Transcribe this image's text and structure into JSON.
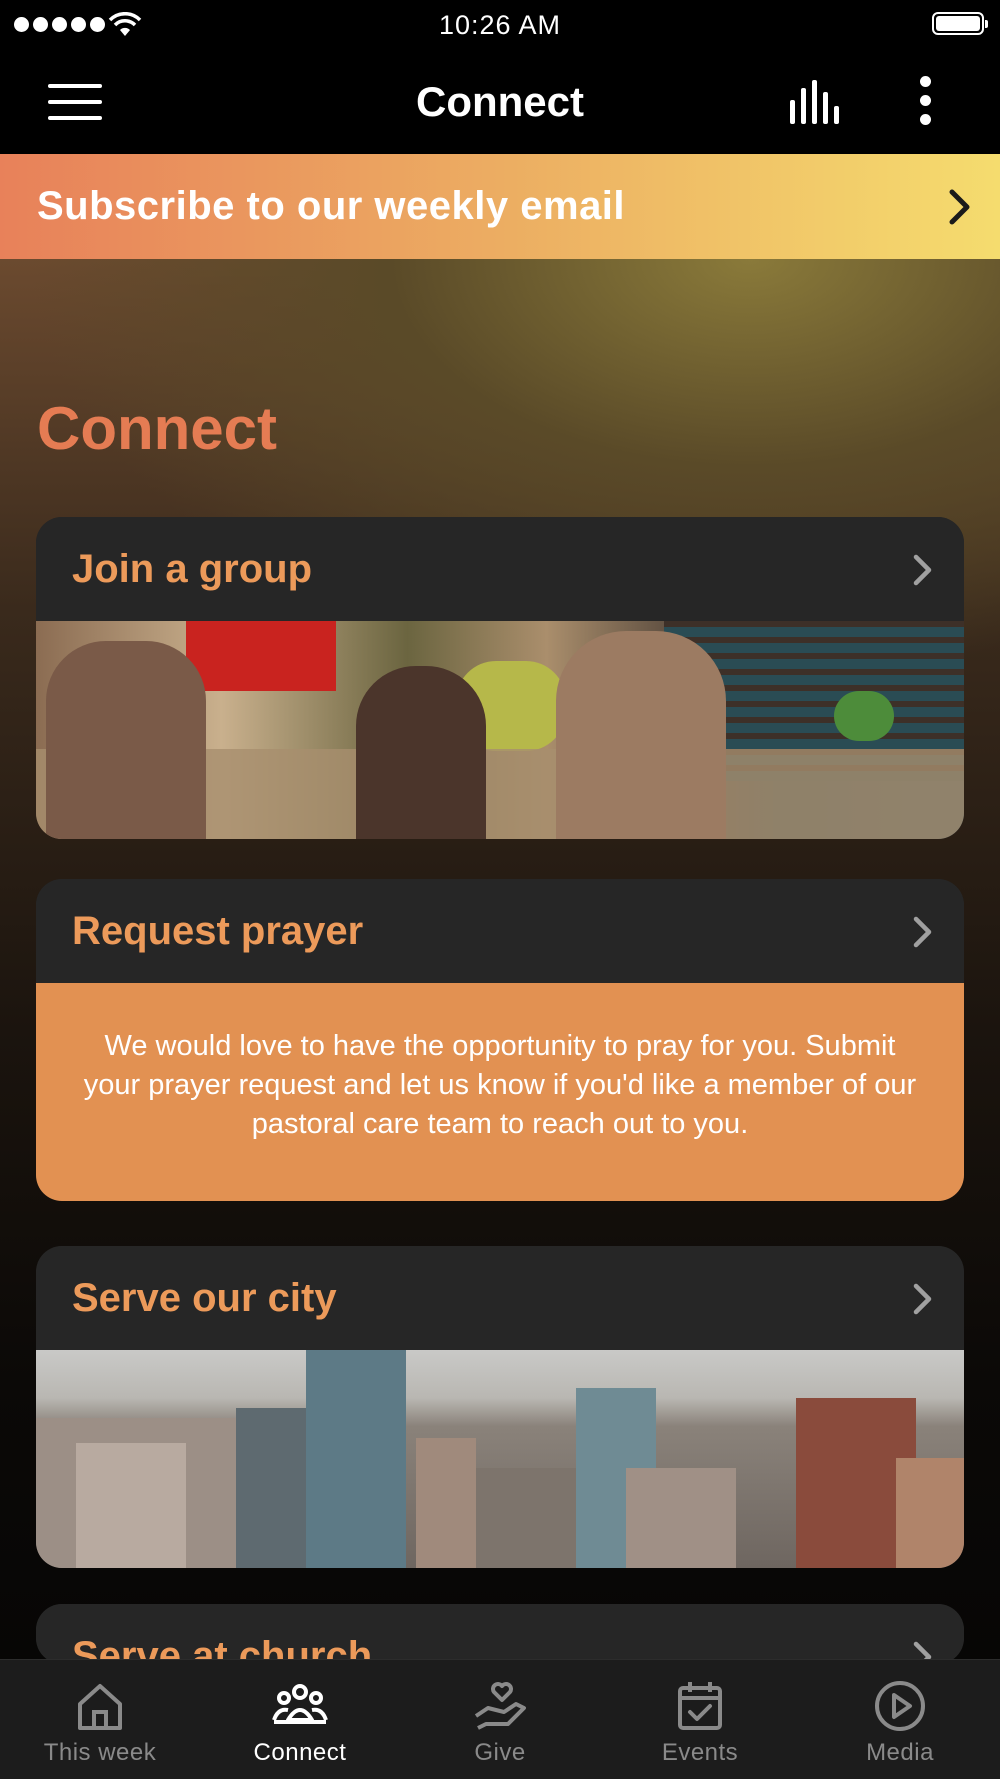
{
  "status_bar": {
    "time": "10:26 AM"
  },
  "nav_bar": {
    "title": "Connect"
  },
  "subscribe_banner": {
    "label": "Subscribe to our weekly email"
  },
  "section": {
    "title": "Connect"
  },
  "cards": [
    {
      "label": "Join a group"
    },
    {
      "label": "Request prayer",
      "body": "We would love to have the opportunity to pray for you. Submit your prayer request and let us know if you'd like a member of our pastoral care team to reach out to you."
    },
    {
      "label": "Serve our city"
    },
    {
      "label": "Serve at church"
    }
  ],
  "tabs": [
    {
      "label": "This week",
      "icon": "home-icon"
    },
    {
      "label": "Connect",
      "icon": "people-icon",
      "active": true
    },
    {
      "label": "Give",
      "icon": "give-icon"
    },
    {
      "label": "Events",
      "icon": "calendar-icon"
    },
    {
      "label": "Media",
      "icon": "play-icon"
    }
  ],
  "colors": {
    "accent": "#e57c53",
    "card_label": "#ec9a5a",
    "prayer_background": "#e29152",
    "banner_gradient": [
      "#e8815a",
      "#ecad62",
      "#f5dc6e"
    ]
  }
}
